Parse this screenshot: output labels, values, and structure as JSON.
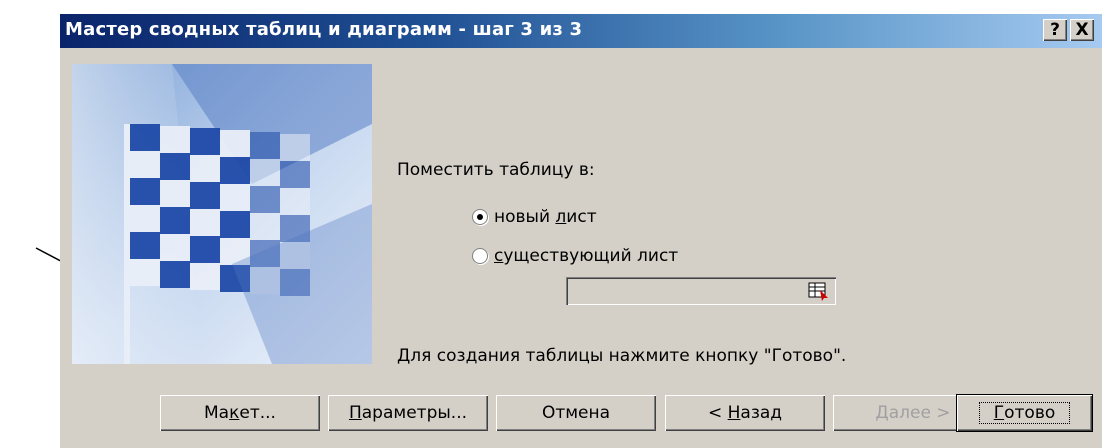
{
  "window": {
    "title": "Мастер сводных таблиц и диаграмм - шаг 3 из 3",
    "help_glyph": "?",
    "close_glyph": "X"
  },
  "main": {
    "place_label": "Поместить таблицу в:",
    "options": [
      {
        "label": "новый лист",
        "selected": true
      },
      {
        "label": "существующий лист",
        "selected": false
      }
    ],
    "range_input_value": "",
    "hint": "Для создания таблицы нажмите кнопку \"Готово\"."
  },
  "buttons": {
    "layout_pre": "Ма",
    "layout_ul": "к",
    "layout_post": "ет...",
    "options_ul": "П",
    "options_post": "араметры...",
    "cancel": "Отмена",
    "back_pre": "< ",
    "back_ul": "Н",
    "back_post": "азад",
    "next": "Далее >",
    "finish_ul": "Г",
    "finish_post": "отово"
  },
  "icons": {
    "wizard_image": "checkered-flag-image",
    "range_picker": "range-select-icon"
  },
  "colors": {
    "dialog_bg": "#d4d0c8",
    "title_from": "#0a246a",
    "title_to": "#a6caf0"
  }
}
